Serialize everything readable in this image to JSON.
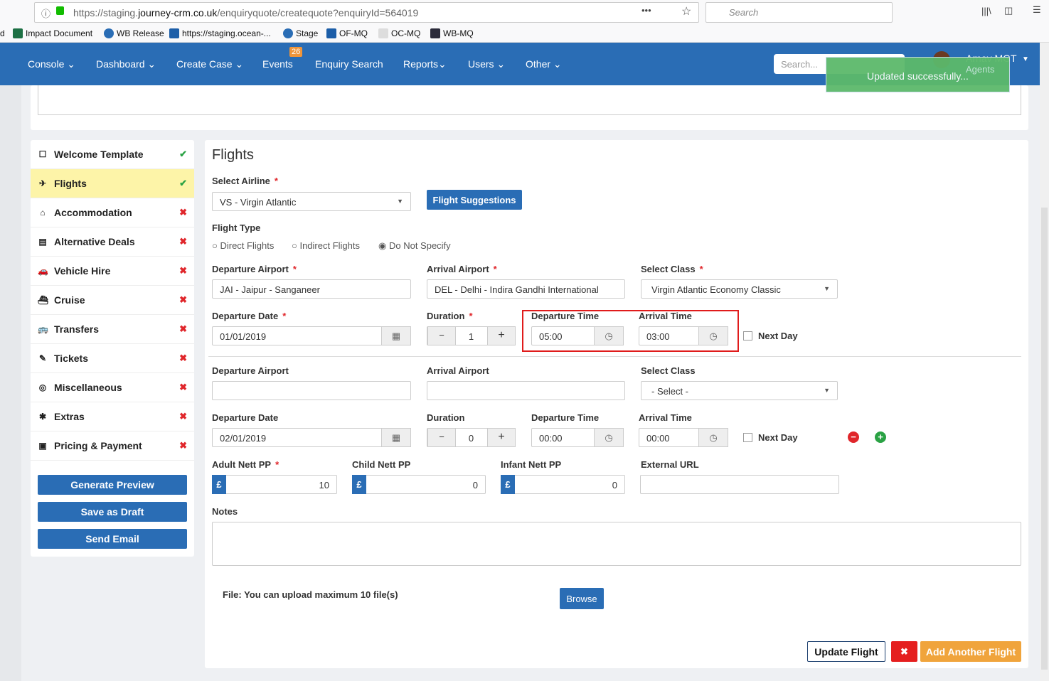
{
  "browser": {
    "url_prefix": "https://staging.",
    "url_domain": "journey-crm.co.uk",
    "url_path": "/enquiryquote/createquote?enquiryId=564019",
    "search_placeholder": "Search",
    "bookmarks": [
      "d",
      "Impact Document",
      "WB Release",
      "https://staging.ocean-...",
      "Stage",
      "OF-MQ",
      "OC-MQ",
      "WB-MQ"
    ]
  },
  "nav": {
    "items": [
      "Console",
      "Dashboard",
      "Create Case",
      "Events",
      "Enquiry Search",
      "Reports",
      "Users",
      "Other"
    ],
    "events_badge": "26",
    "search_placeholder": "Search...",
    "user_name": "Arnav MGT",
    "user_role": "Agents"
  },
  "toast": "Updated successfully...",
  "sidebar": {
    "items": [
      {
        "label": "Welcome Template",
        "status": "✔"
      },
      {
        "label": "Flights",
        "status": "✔"
      },
      {
        "label": "Accommodation",
        "status": "✖"
      },
      {
        "label": "Alternative Deals",
        "status": "✖"
      },
      {
        "label": "Vehicle Hire",
        "status": "✖"
      },
      {
        "label": "Cruise",
        "status": "✖"
      },
      {
        "label": "Transfers",
        "status": "✖"
      },
      {
        "label": "Tickets",
        "status": "✖"
      },
      {
        "label": "Miscellaneous",
        "status": "✖"
      },
      {
        "label": "Extras",
        "status": "✖"
      },
      {
        "label": "Pricing & Payment",
        "status": "✖"
      }
    ],
    "buttons": [
      "Generate Preview",
      "Save as Draft",
      "Send Email"
    ]
  },
  "flights": {
    "title": "Flights",
    "airline_label": "Select Airline",
    "airline_value": "VS - Virgin Atlantic",
    "suggestions": "Flight Suggestions",
    "flight_type_label": "Flight Type",
    "flight_types": [
      "Direct Flights",
      "Indirect Flights",
      "Do Not Specify"
    ],
    "leg1": {
      "dep_airport_label": "Departure Airport",
      "dep_airport": "JAI - Jaipur - Sanganeer",
      "arr_airport_label": "Arrival Airport",
      "arr_airport": "DEL - Delhi - Indira Gandhi International",
      "class_label": "Select Class",
      "class": "Virgin Atlantic Economy Classic",
      "date_label": "Departure Date",
      "date": "01/01/2019",
      "duration_label": "Duration",
      "duration": "1",
      "dep_time_label": "Departure Time",
      "dep_time": "05:00",
      "arr_time_label": "Arrival Time",
      "arr_time": "03:00",
      "next_day": "Next Day"
    },
    "leg2": {
      "dep_airport_label": "Departure Airport",
      "arr_airport_label": "Arrival Airport",
      "class_label": "Select Class",
      "class": "- Select -",
      "date_label": "Departure Date",
      "date": "02/01/2019",
      "duration_label": "Duration",
      "duration": "0",
      "dep_time_label": "Departure Time",
      "dep_time": "00:00",
      "arr_time_label": "Arrival Time",
      "arr_time": "00:00",
      "next_day": "Next Day"
    },
    "adult_label": "Adult Nett PP",
    "adult": "10",
    "child_label": "Child Nett PP",
    "child": "0",
    "infant_label": "Infant Nett PP",
    "infant": "0",
    "currency": "£",
    "url_label": "External URL",
    "notes_label": "Notes",
    "file_text": "File: You can upload maximum 10 file(s)",
    "browse": "Browse",
    "update": "Update Flight",
    "add_another": "Add Another Flight"
  }
}
